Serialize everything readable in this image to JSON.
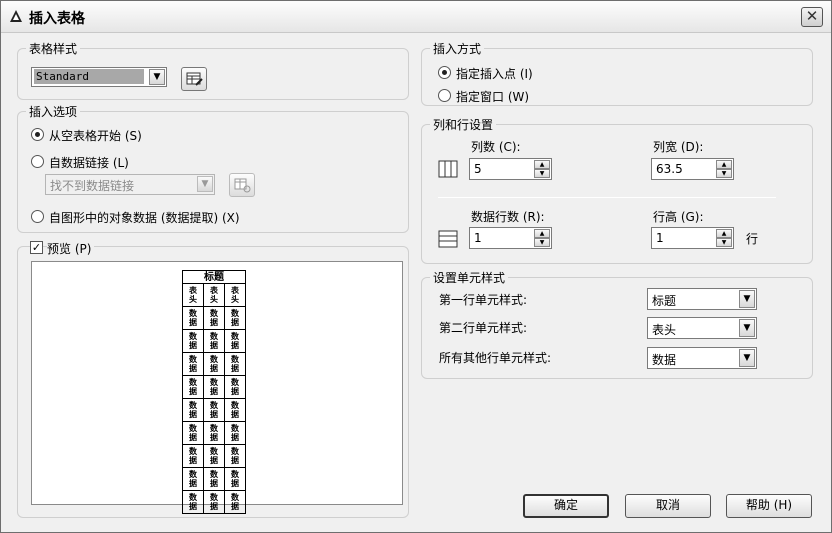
{
  "window": {
    "title": "插入表格",
    "close_glyph": "✕"
  },
  "table_style": {
    "legend": "表格样式",
    "selected": "Standard"
  },
  "insert_options": {
    "legend": "插入选项",
    "opt_empty": "从空表格开始 (S)",
    "opt_datalink": "自数据链接 (L)",
    "datalink_placeholder": "找不到数据链接",
    "opt_extract": "自图形中的对象数据 (数据提取) (X)"
  },
  "preview": {
    "label": "预览 (P)",
    "checked": true,
    "table": {
      "title": "标题",
      "header": [
        "表头",
        "表头",
        "表头"
      ],
      "data_cell": "数据",
      "data_row_count": 9
    }
  },
  "insert_method": {
    "legend": "插入方式",
    "opt_point": "指定插入点 (I)",
    "opt_window": "指定窗口 (W)"
  },
  "col_row": {
    "legend": "列和行设置",
    "columns_label": "列数 (C):",
    "columns_value": "5",
    "col_width_label": "列宽 (D):",
    "col_width_value": "63.5",
    "data_rows_label": "数据行数 (R):",
    "data_rows_value": "1",
    "row_height_label": "行高 (G):",
    "row_height_value": "1",
    "row_height_unit": "行"
  },
  "cell_styles": {
    "legend": "设置单元样式",
    "first_row_label": "第一行单元样式:",
    "first_row_value": "标题",
    "second_row_label": "第二行单元样式:",
    "second_row_value": "表头",
    "other_rows_label": "所有其他行单元样式:",
    "other_rows_value": "数据"
  },
  "buttons": {
    "ok": "确定",
    "cancel": "取消",
    "help": "帮助 (H)"
  }
}
